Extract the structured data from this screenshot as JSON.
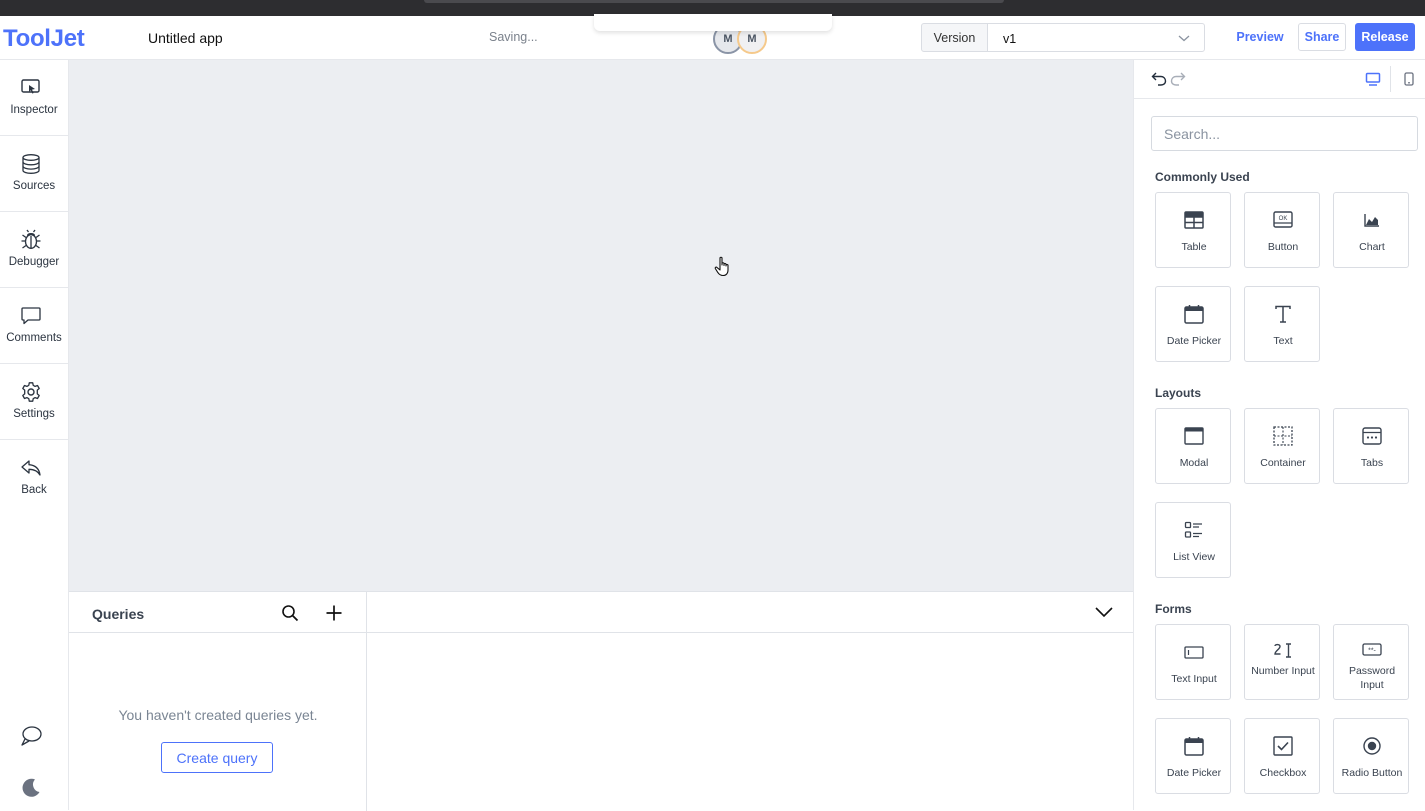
{
  "header": {
    "logo": "ToolJet",
    "app_name": "Untitled app",
    "saving_status": "Saving...",
    "avatars": [
      "M",
      "M"
    ],
    "version_label": "Version",
    "version_value": "v1",
    "preview_label": "Preview",
    "share_label": "Share",
    "release_label": "Release"
  },
  "sidebar": {
    "items": [
      {
        "label": "Inspector",
        "icon": "inspector-icon"
      },
      {
        "label": "Sources",
        "icon": "database-icon"
      },
      {
        "label": "Debugger",
        "icon": "bug-icon"
      },
      {
        "label": "Comments",
        "icon": "comment-icon"
      },
      {
        "label": "Settings",
        "icon": "gear-icon"
      },
      {
        "label": "Back",
        "icon": "back-arrow-icon"
      }
    ]
  },
  "queries": {
    "title": "Queries",
    "empty_text": "You haven't created queries yet.",
    "create_label": "Create query"
  },
  "components_panel": {
    "search_placeholder": "Search...",
    "sections": [
      {
        "title": "Commonly Used",
        "items": [
          "Table",
          "Button",
          "Chart",
          "Date Picker",
          "Text"
        ]
      },
      {
        "title": "Layouts",
        "items": [
          "Modal",
          "Container",
          "Tabs",
          "List View"
        ]
      },
      {
        "title": "Forms",
        "items": [
          "Text Input",
          "Number Input",
          "Password Input",
          "Date Picker",
          "Checkbox",
          "Radio Button"
        ]
      }
    ]
  },
  "colors": {
    "accent": "#4d72fa",
    "canvas_bg": "#eceef2"
  }
}
